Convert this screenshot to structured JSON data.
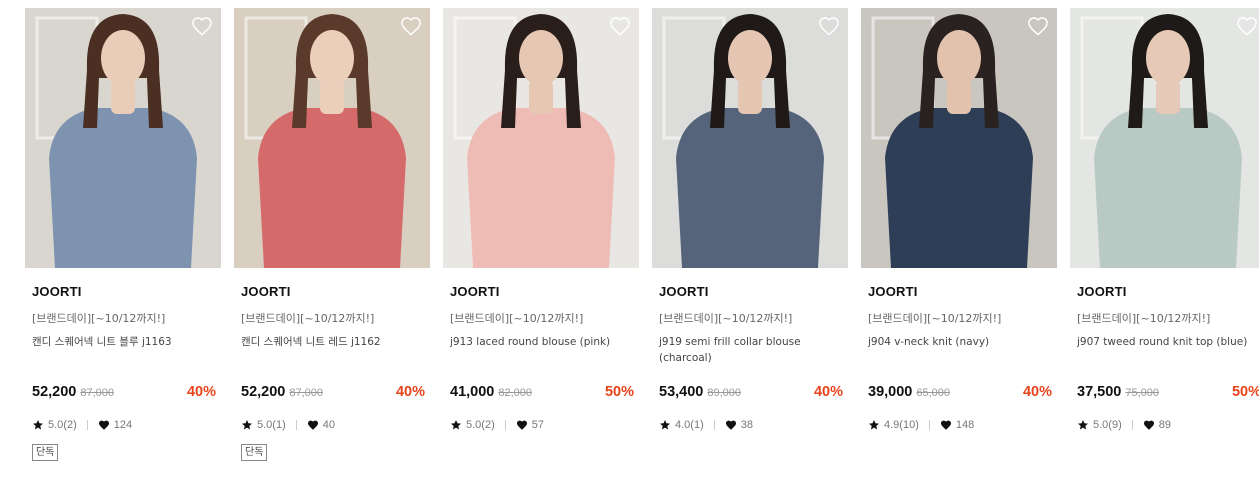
{
  "products": [
    {
      "brand": "JOORTI",
      "promo": "[브랜드데이][~10/12까지!]",
      "name": "캔디 스퀘어넥 니트 블루 j1163",
      "price": "52,200",
      "original_price": "87,000",
      "discount": "40%",
      "rating": "5.0(2)",
      "likes": "124",
      "badge": "단독",
      "colors": {
        "bg": "#d9d6cf",
        "garment": "#7e93b0",
        "hair": "#4a2f22",
        "skin": "#e8cdb9",
        "bottom": "#9aa9bd"
      }
    },
    {
      "brand": "JOORTI",
      "promo": "[브랜드데이][~10/12까지!]",
      "name": "캔디 스퀘어넥 니트 레드 j1162",
      "price": "52,200",
      "original_price": "87,000",
      "discount": "40%",
      "rating": "5.0(1)",
      "likes": "40",
      "badge": "단독",
      "colors": {
        "bg": "#d8cfc1",
        "garment": "#d56a6a",
        "hair": "#5a3a2a",
        "skin": "#eccfba",
        "bottom": "#f3f1ec"
      }
    },
    {
      "brand": "JOORTI",
      "promo": "[브랜드데이][~10/12까지!]",
      "name": "j913 laced round blouse (pink)",
      "price": "41,000",
      "original_price": "82,000",
      "discount": "50%",
      "rating": "5.0(2)",
      "likes": "57",
      "badge": "",
      "colors": {
        "bg": "#e9e7e4",
        "garment": "#efbcb5",
        "hair": "#2a1e1a",
        "skin": "#e6c7b3",
        "bottom": "#d9d5cc"
      }
    },
    {
      "brand": "JOORTI",
      "promo": "[브랜드데이][~10/12까지!]",
      "name": "j919 semi frill collar blouse (charcoal)",
      "price": "53,400",
      "original_price": "89,000",
      "discount": "40%",
      "rating": "4.0(1)",
      "likes": "38",
      "badge": "",
      "colors": {
        "bg": "#dcdcda",
        "garment": "#55647a",
        "hair": "#1f1a18",
        "skin": "#e4c6b3",
        "bottom": "#4d5a6e"
      }
    },
    {
      "brand": "JOORTI",
      "promo": "[브랜드데이][~10/12까지!]",
      "name": "j904 v-neck knit (navy)",
      "price": "39,000",
      "original_price": "65,000",
      "discount": "40%",
      "rating": "4.9(10)",
      "likes": "148",
      "badge": "",
      "colors": {
        "bg": "#c9c6c0",
        "garment": "#2f3e57",
        "hair": "#2a2220",
        "skin": "#e2c2ac",
        "bottom": "#e3ddd0"
      }
    },
    {
      "brand": "JOORTI",
      "promo": "[브랜드데이][~10/12까지!]",
      "name": "j907 tweed round knit top (blue)",
      "price": "37,500",
      "original_price": "75,000",
      "discount": "50%",
      "rating": "5.0(9)",
      "likes": "89",
      "badge": "",
      "colors": {
        "bg": "#e4e6e3",
        "garment": "#b9c9c4",
        "hair": "#1e1a18",
        "skin": "#e6c9b6",
        "bottom": "#d6d0c6"
      }
    }
  ],
  "icons": {
    "wishlist": "heart-outline-icon",
    "star": "star-icon",
    "like": "heart-filled-icon"
  },
  "accent": {
    "discount": "#e8441c"
  }
}
